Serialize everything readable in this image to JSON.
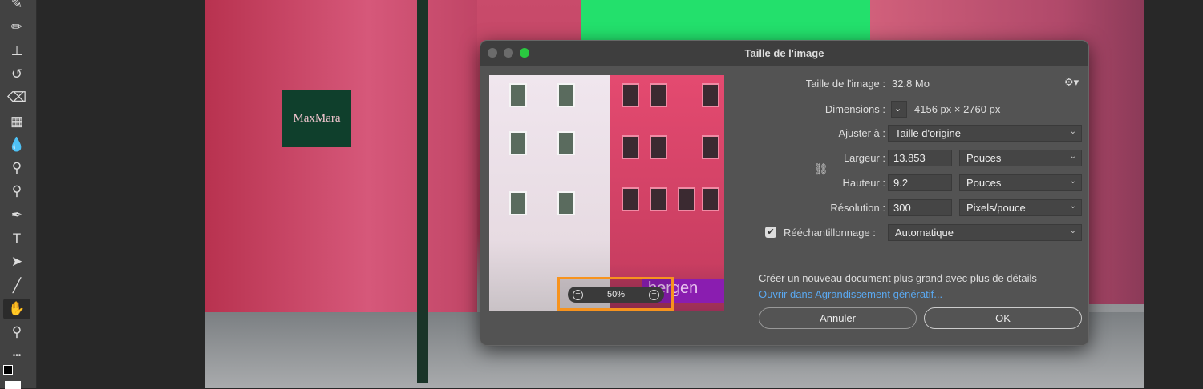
{
  "toolbar": {
    "tools": [
      {
        "name": "brush-tool",
        "glyph": "✎"
      },
      {
        "name": "pencil-tool",
        "glyph": "✏"
      },
      {
        "name": "clone-stamp-tool",
        "glyph": "⊥"
      },
      {
        "name": "history-brush-tool",
        "glyph": "↺"
      },
      {
        "name": "eraser-tool",
        "glyph": "⌫"
      },
      {
        "name": "gradient-tool",
        "glyph": "▦"
      },
      {
        "name": "blur-tool",
        "glyph": "💧"
      },
      {
        "name": "dodge-tool",
        "glyph": "⚲"
      },
      {
        "name": "sponge-tool",
        "glyph": "⚲"
      },
      {
        "name": "pen-tool",
        "glyph": "✒"
      },
      {
        "name": "type-tool",
        "glyph": "T"
      },
      {
        "name": "path-selection-tool",
        "glyph": "➤"
      },
      {
        "name": "line-tool",
        "glyph": "╱"
      },
      {
        "name": "hand-tool",
        "glyph": "✋"
      },
      {
        "name": "zoom-tool",
        "glyph": "⚲"
      },
      {
        "name": "more-tools",
        "glyph": "•••"
      }
    ]
  },
  "canvas": {
    "sign_text": "MaxMara"
  },
  "dialog": {
    "title": "Taille de l'image",
    "preview": {
      "zoom": "50%",
      "zoom_out": "−",
      "zoom_in": "+"
    },
    "image_size_label": "Taille de l'image :",
    "image_size_value": "32.8 Mo",
    "dimensions_label": "Dimensions :",
    "dimensions_value": "4156 px  ×  2760 px",
    "fit_label": "Ajuster à :",
    "fit_value": "Taille d'origine",
    "width_label": "Largeur :",
    "width_value": "13.853",
    "width_unit": "Pouces",
    "height_label": "Hauteur :",
    "height_value": "9.2",
    "height_unit": "Pouces",
    "resolution_label": "Résolution :",
    "resolution_value": "300",
    "resolution_unit": "Pixels/pouce",
    "resample_label": "Rééchantillonnage :",
    "resample_checked": true,
    "resample_value": "Automatique",
    "promo_text": "Créer un nouveau document plus grand avec plus de détails",
    "promo_link": "Ouvrir dans Agrandissement génératif...",
    "cancel_label": "Annuler",
    "ok_label": "OK"
  }
}
